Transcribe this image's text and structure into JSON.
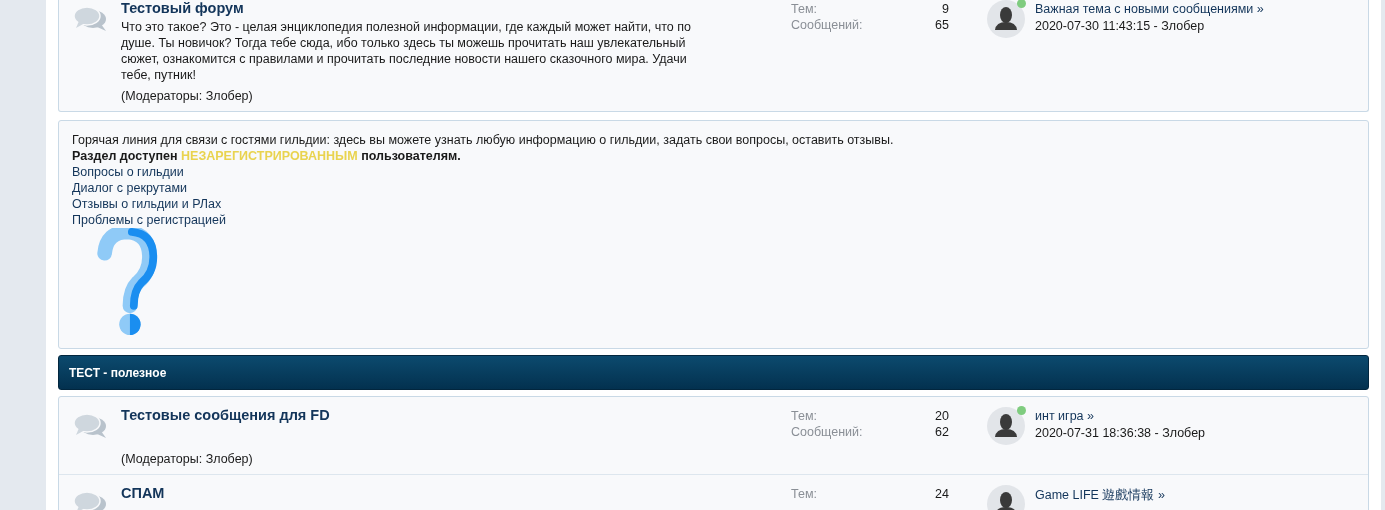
{
  "top_forums": [
    {
      "title": "Тестовый форум",
      "description": "Что это такое? Это - целая энциклопедия полезной информации, где каждый может найти, что по душе. Ты новичок? Тогда тебе сюда, ибо только здесь ты можешь прочитать наш увлекательный сюжет, ознакомится с правилами и прочитать последние новости нашего сказочного мира. Удачи тебе, путник!",
      "moderators": "(Модераторы: Злобер)",
      "topics_label": "Тем:",
      "topics": "9",
      "posts_label": "Сообщений:",
      "posts": "65",
      "last_topic": "Важная тема с новыми сообщениями",
      "arrow": "»",
      "last_meta": "2020-07-30 11:43:15 - Злобер",
      "online": true
    }
  ],
  "guest_block": {
    "intro": "Горячая линия для связи с гостями гильдии: здесь вы можете узнать любую информацию о гильдии, задать свои вопросы, оставить отзывы.",
    "notice": [
      {
        "text": "Раздел доступен ",
        "kind": "plain"
      },
      {
        "text": "НЕЗАРЕГИСТРИРОВАННЫМ",
        "kind": "highlight"
      },
      {
        "text": " пользователям.",
        "kind": "plain"
      }
    ],
    "links": [
      "Вопросы о гильдии",
      "Диалог с рекрутами",
      "Отзывы о гильдии и РЛах",
      "Проблемы с регистрацией"
    ]
  },
  "category": {
    "title": "ТЕСТ - полезное",
    "forums": [
      {
        "title": "Тестовые сообщения для FD",
        "moderators": "(Модераторы: Злобер)",
        "topics_label": "Тем:",
        "topics": "20",
        "posts_label": "Сообщений:",
        "posts": "62",
        "last_topic": "инт игра",
        "arrow": "»",
        "last_meta": "2020-07-31 18:36:38 - Злобер",
        "online": true
      },
      {
        "title": "СПАМ",
        "topics_label": "Тем:",
        "topics": "24",
        "last_topic": "Game LIFE 遊戲情報",
        "arrow": "»",
        "online": false
      }
    ]
  }
}
